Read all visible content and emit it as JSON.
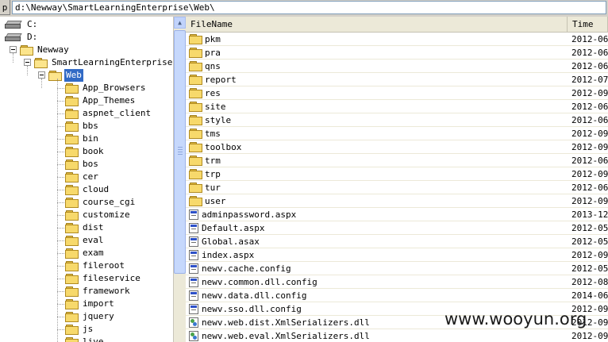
{
  "pathbar": {
    "button_label": "p",
    "path": "d:\\Newway\\SmartLearningEnterprise\\Web\\"
  },
  "tree": {
    "drives": [
      {
        "label": "C:"
      },
      {
        "label": "D:"
      }
    ],
    "expanded": [
      {
        "label": "Newway"
      },
      {
        "label": "SmartLearningEnterprise"
      },
      {
        "label": "Web"
      }
    ],
    "children": [
      {
        "label": "App_Browsers"
      },
      {
        "label": "App_Themes"
      },
      {
        "label": "aspnet_client"
      },
      {
        "label": "bbs"
      },
      {
        "label": "bin"
      },
      {
        "label": "book"
      },
      {
        "label": "bos"
      },
      {
        "label": "cer"
      },
      {
        "label": "cloud"
      },
      {
        "label": "course_cgi"
      },
      {
        "label": "customize"
      },
      {
        "label": "dist"
      },
      {
        "label": "eval"
      },
      {
        "label": "exam"
      },
      {
        "label": "fileroot"
      },
      {
        "label": "fileservice"
      },
      {
        "label": "framework"
      },
      {
        "label": "import"
      },
      {
        "label": "jquery"
      },
      {
        "label": "js"
      },
      {
        "label": "live"
      }
    ]
  },
  "list": {
    "columns": {
      "name": "FileName",
      "time": "Time"
    },
    "rows": [
      {
        "name": "pkm",
        "time": "2012-06",
        "kind": "folder"
      },
      {
        "name": "pra",
        "time": "2012-06",
        "kind": "folder"
      },
      {
        "name": "qns",
        "time": "2012-06",
        "kind": "folder"
      },
      {
        "name": "report",
        "time": "2012-07",
        "kind": "folder"
      },
      {
        "name": "res",
        "time": "2012-09",
        "kind": "folder"
      },
      {
        "name": "site",
        "time": "2012-06",
        "kind": "folder"
      },
      {
        "name": "style",
        "time": "2012-06",
        "kind": "folder"
      },
      {
        "name": "tms",
        "time": "2012-09",
        "kind": "folder"
      },
      {
        "name": "toolbox",
        "time": "2012-09",
        "kind": "folder"
      },
      {
        "name": "trm",
        "time": "2012-06",
        "kind": "folder"
      },
      {
        "name": "trp",
        "time": "2012-09",
        "kind": "folder"
      },
      {
        "name": "tur",
        "time": "2012-06",
        "kind": "folder"
      },
      {
        "name": "user",
        "time": "2012-09",
        "kind": "folder"
      },
      {
        "name": "adminpassword.aspx",
        "time": "2013-12",
        "kind": "page"
      },
      {
        "name": "Default.aspx",
        "time": "2012-05",
        "kind": "page"
      },
      {
        "name": "Global.asax",
        "time": "2012-05",
        "kind": "page"
      },
      {
        "name": "index.aspx",
        "time": "2012-09",
        "kind": "page"
      },
      {
        "name": "newv.cache.config",
        "time": "2012-05",
        "kind": "page"
      },
      {
        "name": "newv.common.dll.config",
        "time": "2012-08",
        "kind": "page"
      },
      {
        "name": "newv.data.dll.config",
        "time": "2014-06",
        "kind": "page"
      },
      {
        "name": "newv.sso.dll.config",
        "time": "2012-09",
        "kind": "page"
      },
      {
        "name": "newv.web.dist.XmlSerializers.dll",
        "time": "2012-09",
        "kind": "dll"
      },
      {
        "name": "newv.web.eval.XmlSerializers.dll",
        "time": "2012-09",
        "kind": "dll"
      }
    ]
  },
  "watermark": "www.wooyun.org",
  "colors": {
    "selection": "#316ac5",
    "folder": "#f7d96b",
    "header_bg": "#ece9d8"
  }
}
